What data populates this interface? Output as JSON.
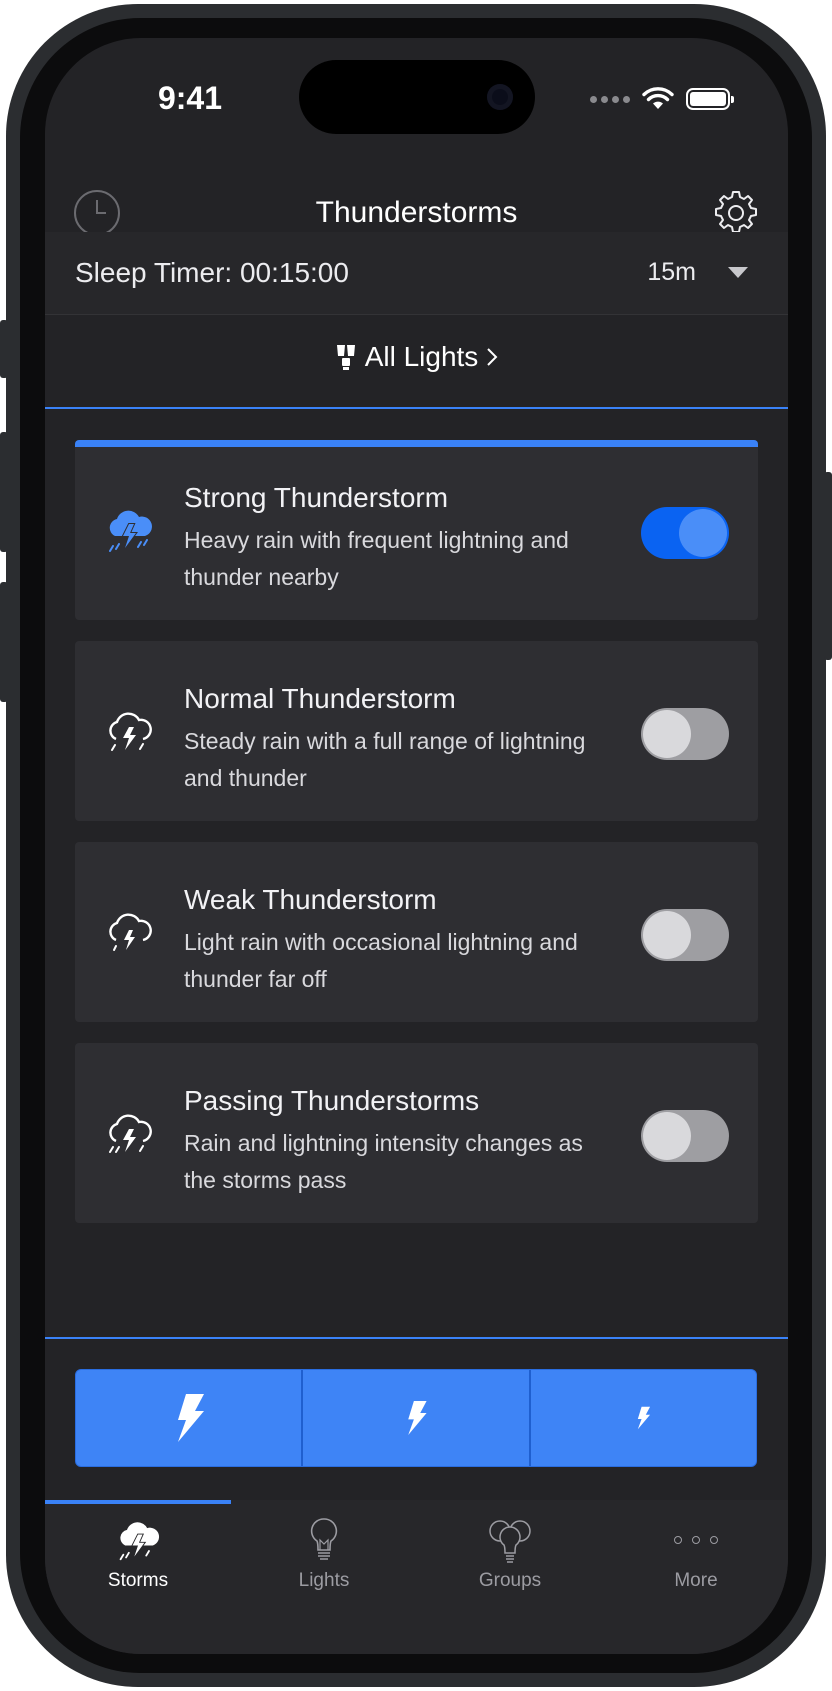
{
  "status_bar": {
    "time": "9:41"
  },
  "nav": {
    "title": "Thunderstorms",
    "left_icon": "clock-icon",
    "right_icon": "gear-icon"
  },
  "sleep_timer": {
    "label": "Sleep Timer: 00:15:00",
    "selected": "15m"
  },
  "lights_link": {
    "label": "All Lights",
    "icon": "light-bulbs-icon"
  },
  "storms": [
    {
      "title": "Strong Thunderstorm",
      "description": "Heavy rain with frequent lightning and thunder nearby",
      "enabled": true
    },
    {
      "title": "Normal Thunderstorm",
      "description": "Steady rain with a full range of lightning and thunder",
      "enabled": false
    },
    {
      "title": "Weak Thunderstorm",
      "description": "Light rain with occasional lightning and thunder far off",
      "enabled": false
    },
    {
      "title": "Passing Thunderstorms",
      "description": "Rain and lightning intensity changes as the storms pass",
      "enabled": false
    }
  ],
  "intensity_buttons": [
    "lightning-large-icon",
    "lightning-medium-icon",
    "lightning-small-icon"
  ],
  "tabs": [
    {
      "label": "Storms",
      "icon": "storm-cloud-icon",
      "active": true
    },
    {
      "label": "Lights",
      "icon": "light-bulb-icon",
      "active": false
    },
    {
      "label": "Groups",
      "icon": "bulb-group-icon",
      "active": false
    },
    {
      "label": "More",
      "icon": "more-dots-icon",
      "active": false
    }
  ],
  "colors": {
    "accent": "#3a82f7",
    "background": "#232326",
    "card": "#2e2e32",
    "toggle_on": "#0a63f2"
  }
}
